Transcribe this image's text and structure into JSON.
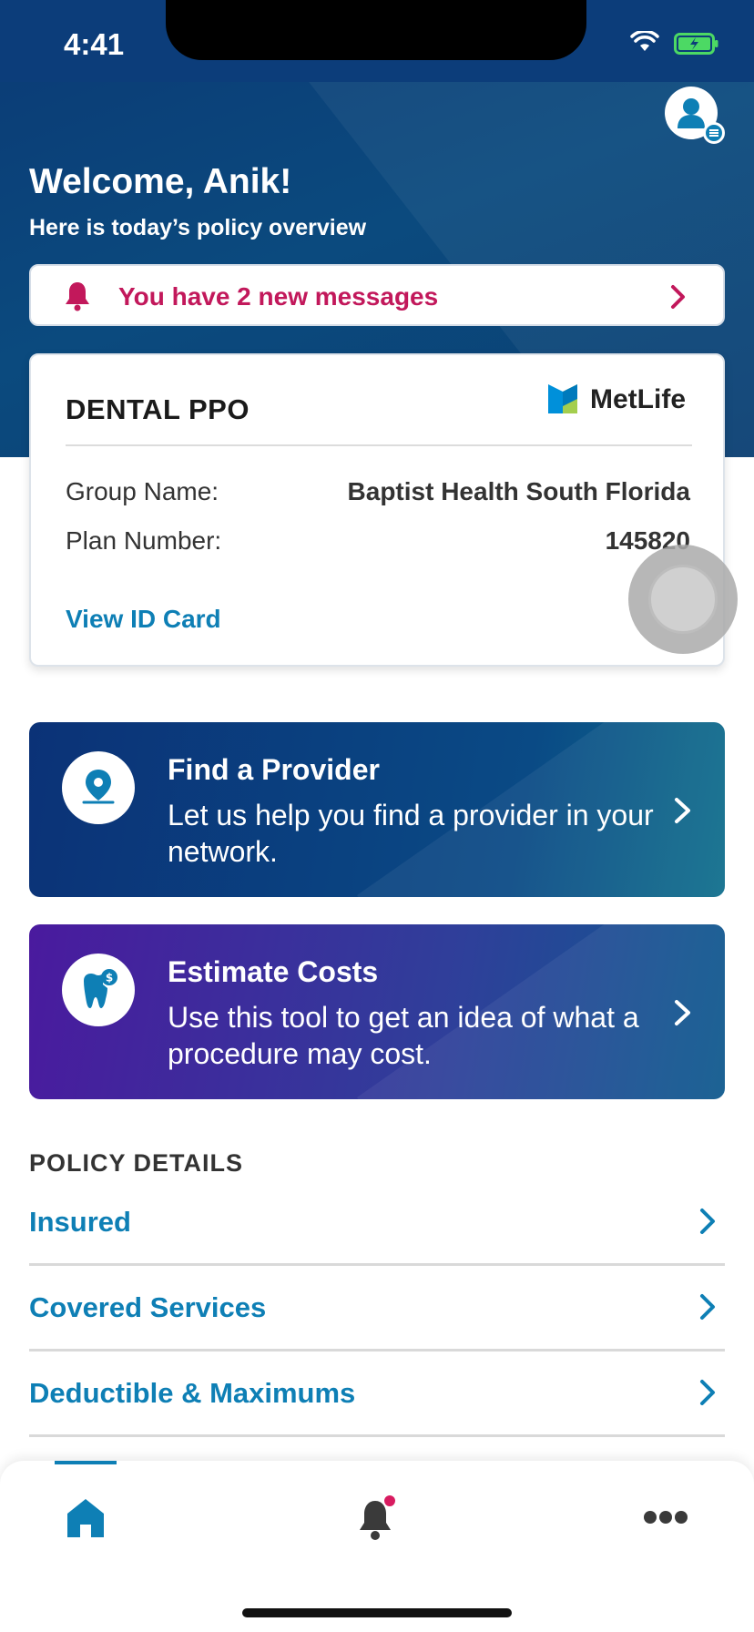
{
  "status_bar": {
    "time": "4:41"
  },
  "header": {
    "welcome": "Welcome, Anik!",
    "subtitle": "Here is today’s policy overview",
    "avatar_icon": "user-profile-icon"
  },
  "messages_banner": {
    "text": "You have 2 new messages",
    "icon": "bell-icon",
    "color": "#c2185b"
  },
  "policy_card": {
    "plan": "DENTAL PPO",
    "brand": "MetLife",
    "rows": [
      {
        "label": "Group Name:",
        "value": "Baptist Health South Florida"
      },
      {
        "label": "Plan Number:",
        "value": "145820"
      }
    ],
    "link": "View ID Card"
  },
  "action_cards": [
    {
      "title": "Find a Provider",
      "description": "Let us help you find a provider in your network.",
      "icon": "location-pin-icon"
    },
    {
      "title": "Estimate Costs",
      "description": "Use this tool to get an idea of what a procedure may cost.",
      "icon": "tooth-dollar-icon"
    }
  ],
  "policy_details": {
    "header": "POLICY DETAILS",
    "items": [
      {
        "label": "Insured"
      },
      {
        "label": "Covered Services"
      },
      {
        "label": "Deductible & Maximums"
      }
    ]
  },
  "tab_bar": {
    "tabs": [
      {
        "name": "home",
        "icon": "home-icon",
        "active": true
      },
      {
        "name": "notifications",
        "icon": "bell-icon",
        "badge": true
      },
      {
        "name": "more",
        "icon": "more-icon"
      }
    ]
  },
  "colors": {
    "primary": "#0e7fb5",
    "hero": "#0b3a75",
    "alert": "#c2185b"
  }
}
